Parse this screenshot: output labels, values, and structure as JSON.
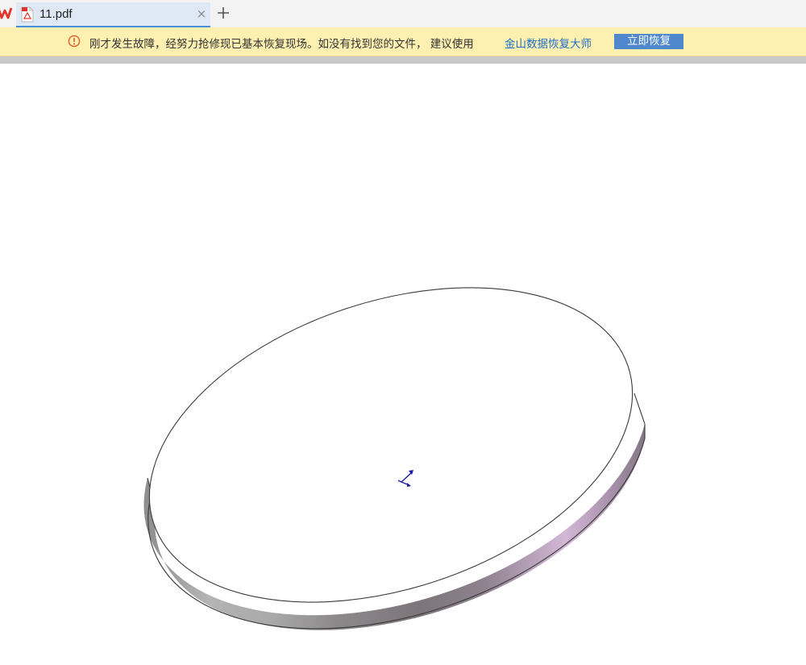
{
  "tabbar": {
    "app_logo_icon": "wps-logo-icon",
    "tabs": [
      {
        "label": "11.pdf",
        "icon": "pdf-file-icon",
        "active": true
      }
    ],
    "close_glyph": "×",
    "new_tab_icon": "plus-icon"
  },
  "notice": {
    "icon": "warning-circle-icon",
    "message": "刚才发生故障，经努力抢修现已基本恢复现场。如没有找到您的文件， 建议使用",
    "link_text": "金山数据恢复大师",
    "button_label": "立即恢复",
    "colors": {
      "background": "#fdf0b0",
      "link": "#1f6fc9",
      "button": "#4f88cc",
      "icon": "#e05a2a"
    }
  },
  "document": {
    "drawing": "cad-disk-isometric",
    "triad_icon": "coordinate-triad-icon"
  }
}
